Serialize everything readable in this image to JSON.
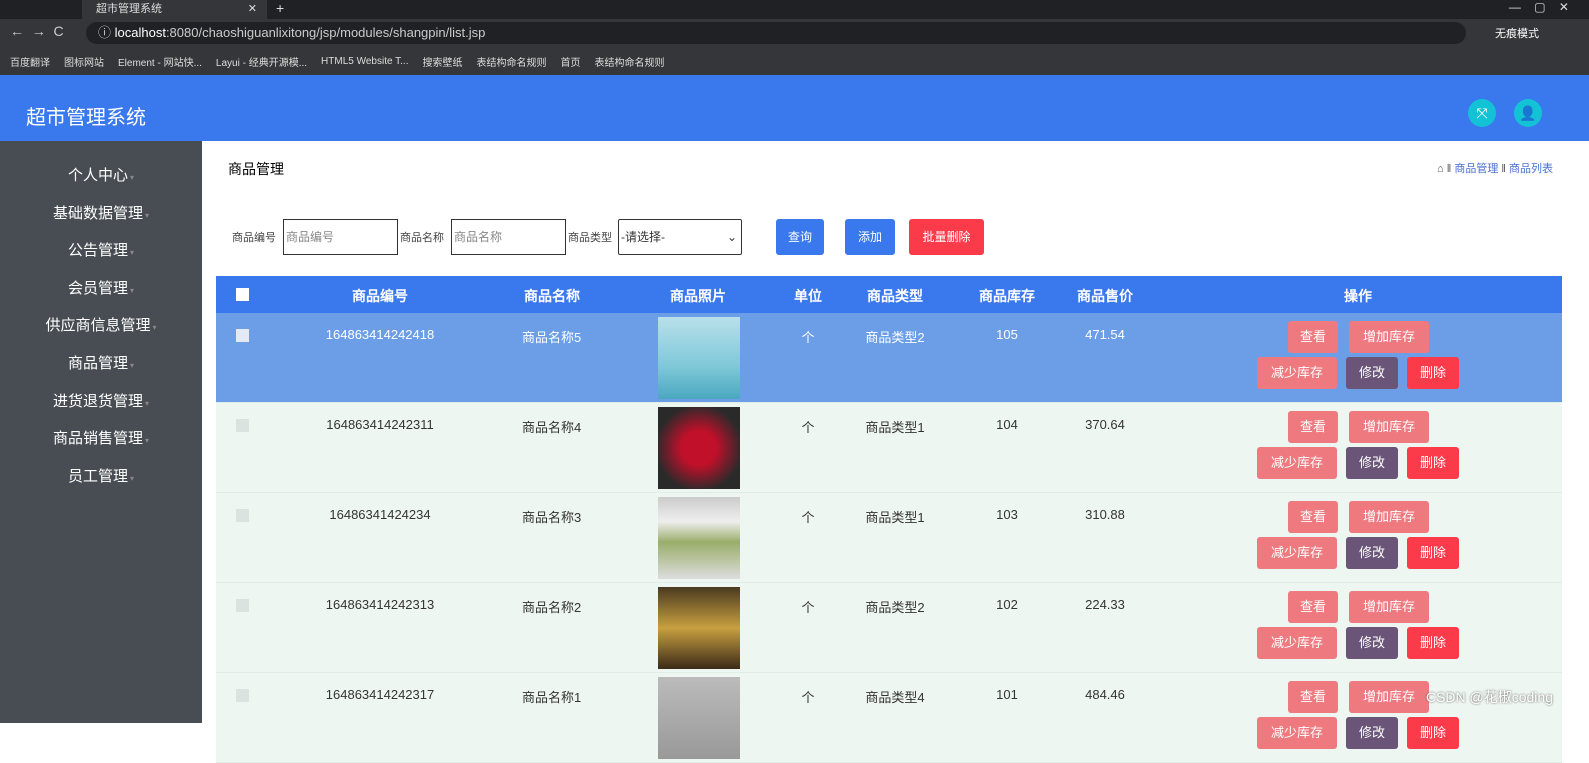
{
  "browser": {
    "tab_title": "超市管理系统",
    "url_host": "localhost",
    "url_rest": ":8080/chaoshiguanlixitong/jsp/modules/shangpin/list.jsp",
    "incognito": "无痕模式",
    "bookmarks": [
      "百度翻译",
      "图标网站",
      "Element - 网站快...",
      "Layui - 经典开源模...",
      "HTML5 Website T...",
      "搜索壁纸",
      "表结构命名规则",
      "首页",
      "表结构命名规则"
    ]
  },
  "header": {
    "title": "超市管理系统"
  },
  "sidebar": [
    "个人中心",
    "基础数据管理",
    "公告管理",
    "会员管理",
    "供应商信息管理",
    "商品管理",
    "进货退货管理",
    "商品销售管理",
    "员工管理"
  ],
  "page": {
    "title": "商品管理",
    "crumb1": "商品管理",
    "crumb2": "商品列表"
  },
  "search": {
    "code_label": "商品编号",
    "code_placeholder": "商品编号",
    "name_label": "商品名称",
    "name_placeholder": "商品名称",
    "type_label": "商品类型",
    "type_value": "-请选择-",
    "query": "查询",
    "add": "添加",
    "batch_delete": "批量删除"
  },
  "columns": [
    "商品编号",
    "商品名称",
    "商品照片",
    "单位",
    "商品类型",
    "商品库存",
    "商品售价",
    "操作"
  ],
  "actions": {
    "view": "查看",
    "add_stock": "增加库存",
    "reduce_stock": "减少库存",
    "edit": "修改",
    "delete": "删除"
  },
  "rows": [
    {
      "code": "164863414242418",
      "name": "商品名称5",
      "unit": "个",
      "type": "商品类型2",
      "stock": "105",
      "price": "471.54"
    },
    {
      "code": "164863414242311",
      "name": "商品名称4",
      "unit": "个",
      "type": "商品类型1",
      "stock": "104",
      "price": "370.64"
    },
    {
      "code": "16486341424234",
      "name": "商品名称3",
      "unit": "个",
      "type": "商品类型1",
      "stock": "103",
      "price": "310.88"
    },
    {
      "code": "164863414242313",
      "name": "商品名称2",
      "unit": "个",
      "type": "商品类型2",
      "stock": "102",
      "price": "224.33"
    },
    {
      "code": "164863414242317",
      "name": "商品名称1",
      "unit": "个",
      "type": "商品类型4",
      "stock": "101",
      "price": "484.46"
    }
  ],
  "watermark": "CSDN @花椒coding"
}
